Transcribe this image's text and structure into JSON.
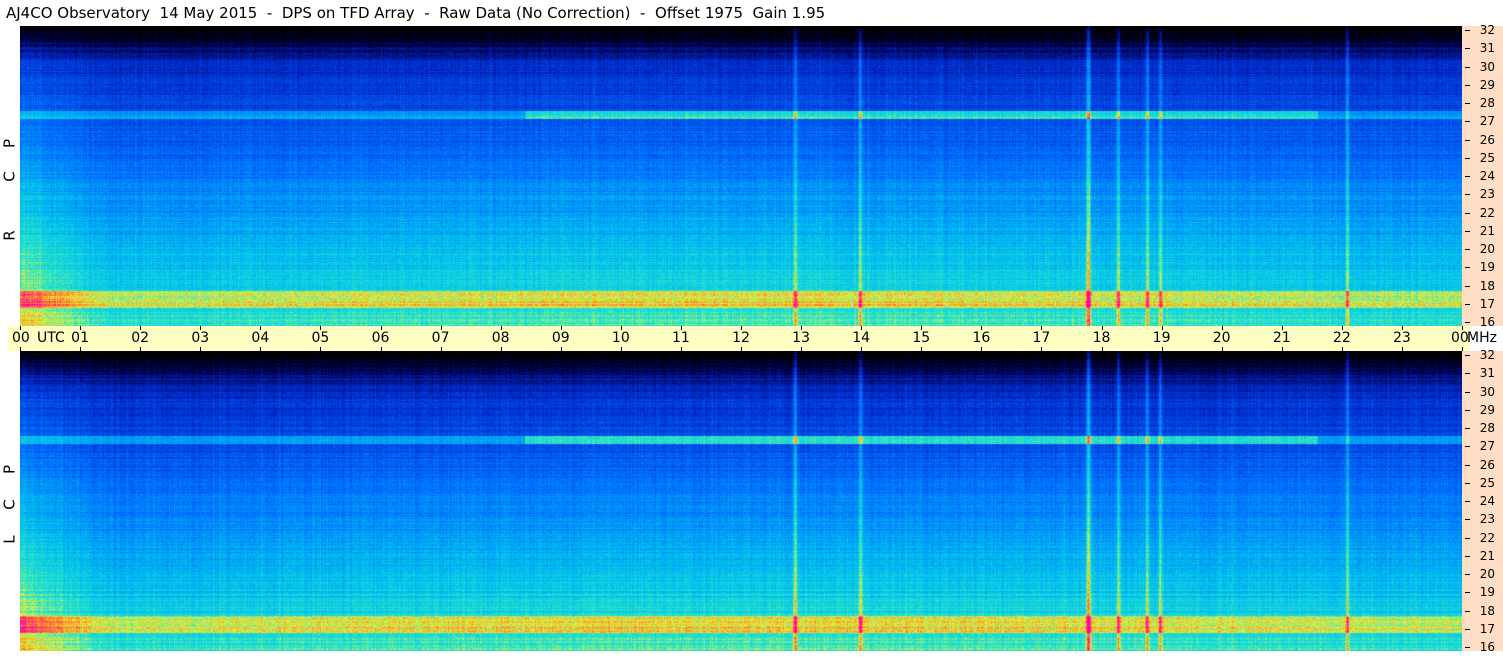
{
  "header": {
    "title": "AJ4CO Observatory  14 May 2015  -  DPS on TFD Array  -  Raw Data (No Correction)  -  Offset 1975  Gain 1.95"
  },
  "panels": [
    {
      "id": "rcp",
      "letters": [
        "R",
        "C",
        "P"
      ]
    },
    {
      "id": "lcp",
      "letters": [
        "L",
        "C",
        "P"
      ]
    }
  ],
  "time_axis": {
    "first_label": "00",
    "utc_label": "UTC",
    "labels": [
      "01",
      "02",
      "03",
      "04",
      "05",
      "06",
      "07",
      "08",
      "09",
      "10",
      "11",
      "12",
      "13",
      "14",
      "15",
      "16",
      "17",
      "18",
      "19",
      "20",
      "21",
      "22",
      "23"
    ],
    "last_label": "00",
    "mhz_label": "MHz"
  },
  "freq_axis": {
    "labels": [
      "32",
      "31",
      "30",
      "29",
      "28",
      "27",
      "26",
      "25",
      "24",
      "23",
      "22",
      "21",
      "20",
      "19",
      "18",
      "17",
      "16"
    ]
  },
  "colors": {
    "freq_axis_bg": "#ffddc4",
    "time_axis_bg": "#ffffc4"
  }
}
